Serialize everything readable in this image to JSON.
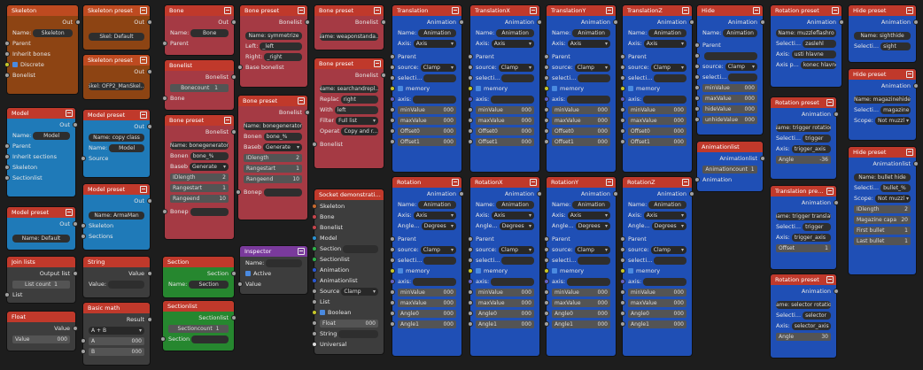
{
  "nodes": {
    "skeleton": {
      "title": "Skeleton",
      "out": "Out",
      "name_label": "Name:",
      "name": "Skeleton",
      "parent": "Parent",
      "inherit": "Inherit bones",
      "discrete": "Discrete",
      "bonelist": "Bonelist"
    },
    "skel_preset1": {
      "title": "Skeleton preset",
      "out": "Out",
      "value": "Skel: Default"
    },
    "skel_preset2": {
      "title": "Skeleton preset",
      "out": "Out",
      "value": "Skel: OFP2_ManSkel..."
    },
    "model": {
      "title": "Model",
      "out": "Out",
      "name_label": "Name:",
      "name": "Model",
      "parent": "Parent",
      "inherit": "Inherit sections",
      "skeleton": "Skeleton",
      "sectionlist": "Sectionlist"
    },
    "model_preset1": {
      "title": "Model preset",
      "out": "Out",
      "value": "Name: copy class",
      "name_label": "Name:",
      "name": "Model",
      "source": "Source"
    },
    "model_preset2": {
      "title": "Model preset",
      "out": "Out",
      "value": "Name: Default"
    },
    "model_preset3": {
      "title": "Model preset",
      "out": "Out",
      "value": "Name: ArmaMan",
      "skeleton": "Skeleton",
      "sections": "Sections"
    },
    "joinlists": {
      "title": "Join lists",
      "out": "Output list",
      "count_label": "List count",
      "count": "1",
      "list": "List"
    },
    "float": {
      "title": "Float",
      "out": "Value",
      "value_label": "Value",
      "value": "000"
    },
    "string": {
      "title": "String",
      "out": "Value",
      "value_label": "Value:"
    },
    "basicmath": {
      "title": "Basic math",
      "out": "Result",
      "op": "A + B",
      "a": "A",
      "av": "000",
      "b": "B",
      "bv": "000"
    },
    "bone": {
      "title": "Bone",
      "out": "Out",
      "name_label": "Name:",
      "name": "Bone",
      "parent": "Parent"
    },
    "bonelist": {
      "title": "Bonelist",
      "out": "Bonelist",
      "count_label": "Bonecount",
      "count": "1",
      "bone": "Bone"
    },
    "bonepreset": {
      "title": "Bone preset",
      "out": "Bonelist",
      "value": "Name: bonegenerator",
      "bonen": "Bonen",
      "bonen_v": "bone_%",
      "baseb": "Baseb",
      "baseb_v": "Generate",
      "idl": "IDlength",
      "idl_v": "2",
      "rs": "Rangestart",
      "rs_v": "1",
      "re": "Rangeend",
      "re_v": "10",
      "bonep": "Bonep"
    },
    "bonepreset2": {
      "title": "Bone preset",
      "out": "Bonelist",
      "value": "Name: symmetrize",
      "left": "Left:",
      "left_v": "_left",
      "right": "Right:",
      "right_v": "_right",
      "base": "Base bonelist"
    },
    "bonepreset3": {
      "title": "Bone preset",
      "out": "Bonelist",
      "value": "Name: bonegenerator",
      "bonen": "Bonen",
      "bonen_v": "bone_%",
      "baseb": "Baseb",
      "baseb_v": "Generate",
      "idl": "IDlength",
      "idl_v": "2",
      "rs": "Rangestart",
      "rs_v": "1",
      "re": "Rangeend",
      "re_v": "10",
      "bonep": "Bonep"
    },
    "bonepreset4": {
      "title": "Bone preset",
      "out": "Bonelist",
      "value": "Name: weaponstanda..."
    },
    "bonepreset5": {
      "title": "Bone preset",
      "out": "Bonelist",
      "value": "Name: searchandrepl...",
      "replace": "Replac",
      "replace_v": "right",
      "with": "With",
      "with_v": "left",
      "filter": "Filter",
      "filter_v": "Full list",
      "oper": "Operat",
      "oper_v": "Copy and r...",
      "bonelist": "Bonelist"
    },
    "section": {
      "title": "Section",
      "out": "Section",
      "name_label": "Name:",
      "name": "Section"
    },
    "sectionlist": {
      "title": "Sectionlist",
      "out": "Sectionlist",
      "count_label": "Sectioncount",
      "count": "1",
      "section": "Section"
    },
    "inspector": {
      "title": "Inspector",
      "name_label": "Name:",
      "active": "Active",
      "value": "Value"
    },
    "socketdemo": {
      "title": "Socket demonstrative",
      "skeleton": "Skeleton",
      "bone": "Bone",
      "bonelist": "Bonelist",
      "model": "Model",
      "section": "Section",
      "sectionlist": "Sectionlist",
      "animation": "Animation",
      "animationlist": "Animationlist",
      "source": "Source",
      "source_v": "Clamp",
      "list": "List",
      "boolean": "Boolean",
      "float": "Float",
      "float_v": "000",
      "string": "String",
      "universal": "Universal"
    },
    "animlist": {
      "title": "Animationlist",
      "out": "Animationlist",
      "count_label": "Animationcount",
      "count": "1",
      "anim": "Animation"
    },
    "hide": {
      "title": "Hide",
      "out": "Animation",
      "name_label": "Name:",
      "name": "Animation",
      "parent": "Parent",
      "source": "source:",
      "source_v": "Clamp",
      "selection": "selecti...",
      "min": "minValue",
      "min_v": "000",
      "max": "maxValue",
      "max_v": "000",
      "hide": "hideValue",
      "hide_v": "000",
      "unhide": "unhideValue",
      "unhide_v": "000"
    },
    "rotpreset1": {
      "title": "Rotation preset",
      "out": "Animation",
      "value": "Name: muzzleflashro",
      "sel": "Selecti...",
      "sel_v": "zaslehl",
      "axis": "Axis:",
      "axis_v": "usti hlavne",
      "axisp": "Axis p...",
      "axisp_v": "konec hlavne"
    },
    "hidepreset1": {
      "title": "Hide preset",
      "out": "Animation",
      "value": "Name: sighthide",
      "sel": "Selecti...",
      "sel_v": "sight"
    },
    "hidepreset2": {
      "title": "Hide preset",
      "out": "Animation",
      "value": "Name: magazinehide",
      "sel": "Selecti...",
      "sel_v": "magazine",
      "scope": "Scope:",
      "scope_v": "Not muzzl"
    },
    "hidepreset3": {
      "title": "Hide preset",
      "out": "Animationlist",
      "value": "Name: bullet hide",
      "sel": "Selecti...",
      "sel_v": "bullet_%",
      "scope": "Scope:",
      "scope_v": "Not muzzl",
      "idl": "IDlength",
      "idl_v": "2",
      "mag": "Magazine capa",
      "mag_v": "20",
      "first": "First bullet",
      "first_v": "1",
      "last": "Last bullet",
      "last_v": "1"
    },
    "rotpreset2": {
      "title": "Rotation preset",
      "out": "Animation",
      "value": "Name: trigger rotation",
      "sel": "Selecti...",
      "sel_v": "trigger",
      "axis": "Axis:",
      "axis_v": "trigger_axis",
      "angle": "Angle",
      "angle_v": "-36"
    },
    "transpreset": {
      "title": "Translation preset",
      "out": "Animation",
      "value": "Name: trigger translati",
      "sel": "Selecti...",
      "sel_v": "trigger",
      "axis": "Axis:",
      "axis_v": "trigger_axis",
      "offset": "Offset",
      "offset_v": "1"
    },
    "rotpreset3": {
      "title": "Rotation preset",
      "out": "Animation",
      "value": "Name: selector rotation",
      "sel": "Selecti...",
      "sel_v": "selector",
      "axis": "Axis:",
      "axis_v": "selector_axis",
      "angle": "Angle",
      "angle_v": "30"
    }
  },
  "anim_nodes": [
    {
      "title": "Translation",
      "mode": "Axis",
      "extra": [
        "Offset0",
        "Offset1"
      ]
    },
    {
      "title": "TranslationX",
      "mode": "Axis",
      "extra": [
        "Offset0",
        "Offset1"
      ]
    },
    {
      "title": "TranslationY",
      "mode": "Axis",
      "extra": [
        "Offset0",
        "Offset1"
      ]
    },
    {
      "title": "TranslationZ",
      "mode": "Axis",
      "extra": [
        "Offset0",
        "Offset1"
      ]
    },
    {
      "title": "Rotation",
      "mode": "Axis",
      "extra": [
        "Angle0",
        "Angle1"
      ],
      "angle": "Degrees"
    },
    {
      "title": "RotationX",
      "mode": "Axis",
      "extra": [
        "Angle0",
        "Angle1"
      ],
      "angle": "Degrees"
    },
    {
      "title": "RotationY",
      "mode": "Axis",
      "extra": [
        "Angle0",
        "Angle1"
      ],
      "angle": "Degrees"
    },
    {
      "title": "RotationZ",
      "mode": "Axis",
      "extra": [
        "Angle0",
        "Angle1"
      ],
      "angle": "Degrees"
    }
  ],
  "anim_common": {
    "out": "Animation",
    "name_label": "Name:",
    "name": "Animation",
    "axis_label": "Axis:",
    "angle_label": "Angle...",
    "parent": "Parent",
    "source": "source:",
    "source_v": "Clamp",
    "selection": "selecti...",
    "memory": "memory",
    "axis": "axis:",
    "min": "minValue",
    "max": "maxValue",
    "zero": "000"
  }
}
